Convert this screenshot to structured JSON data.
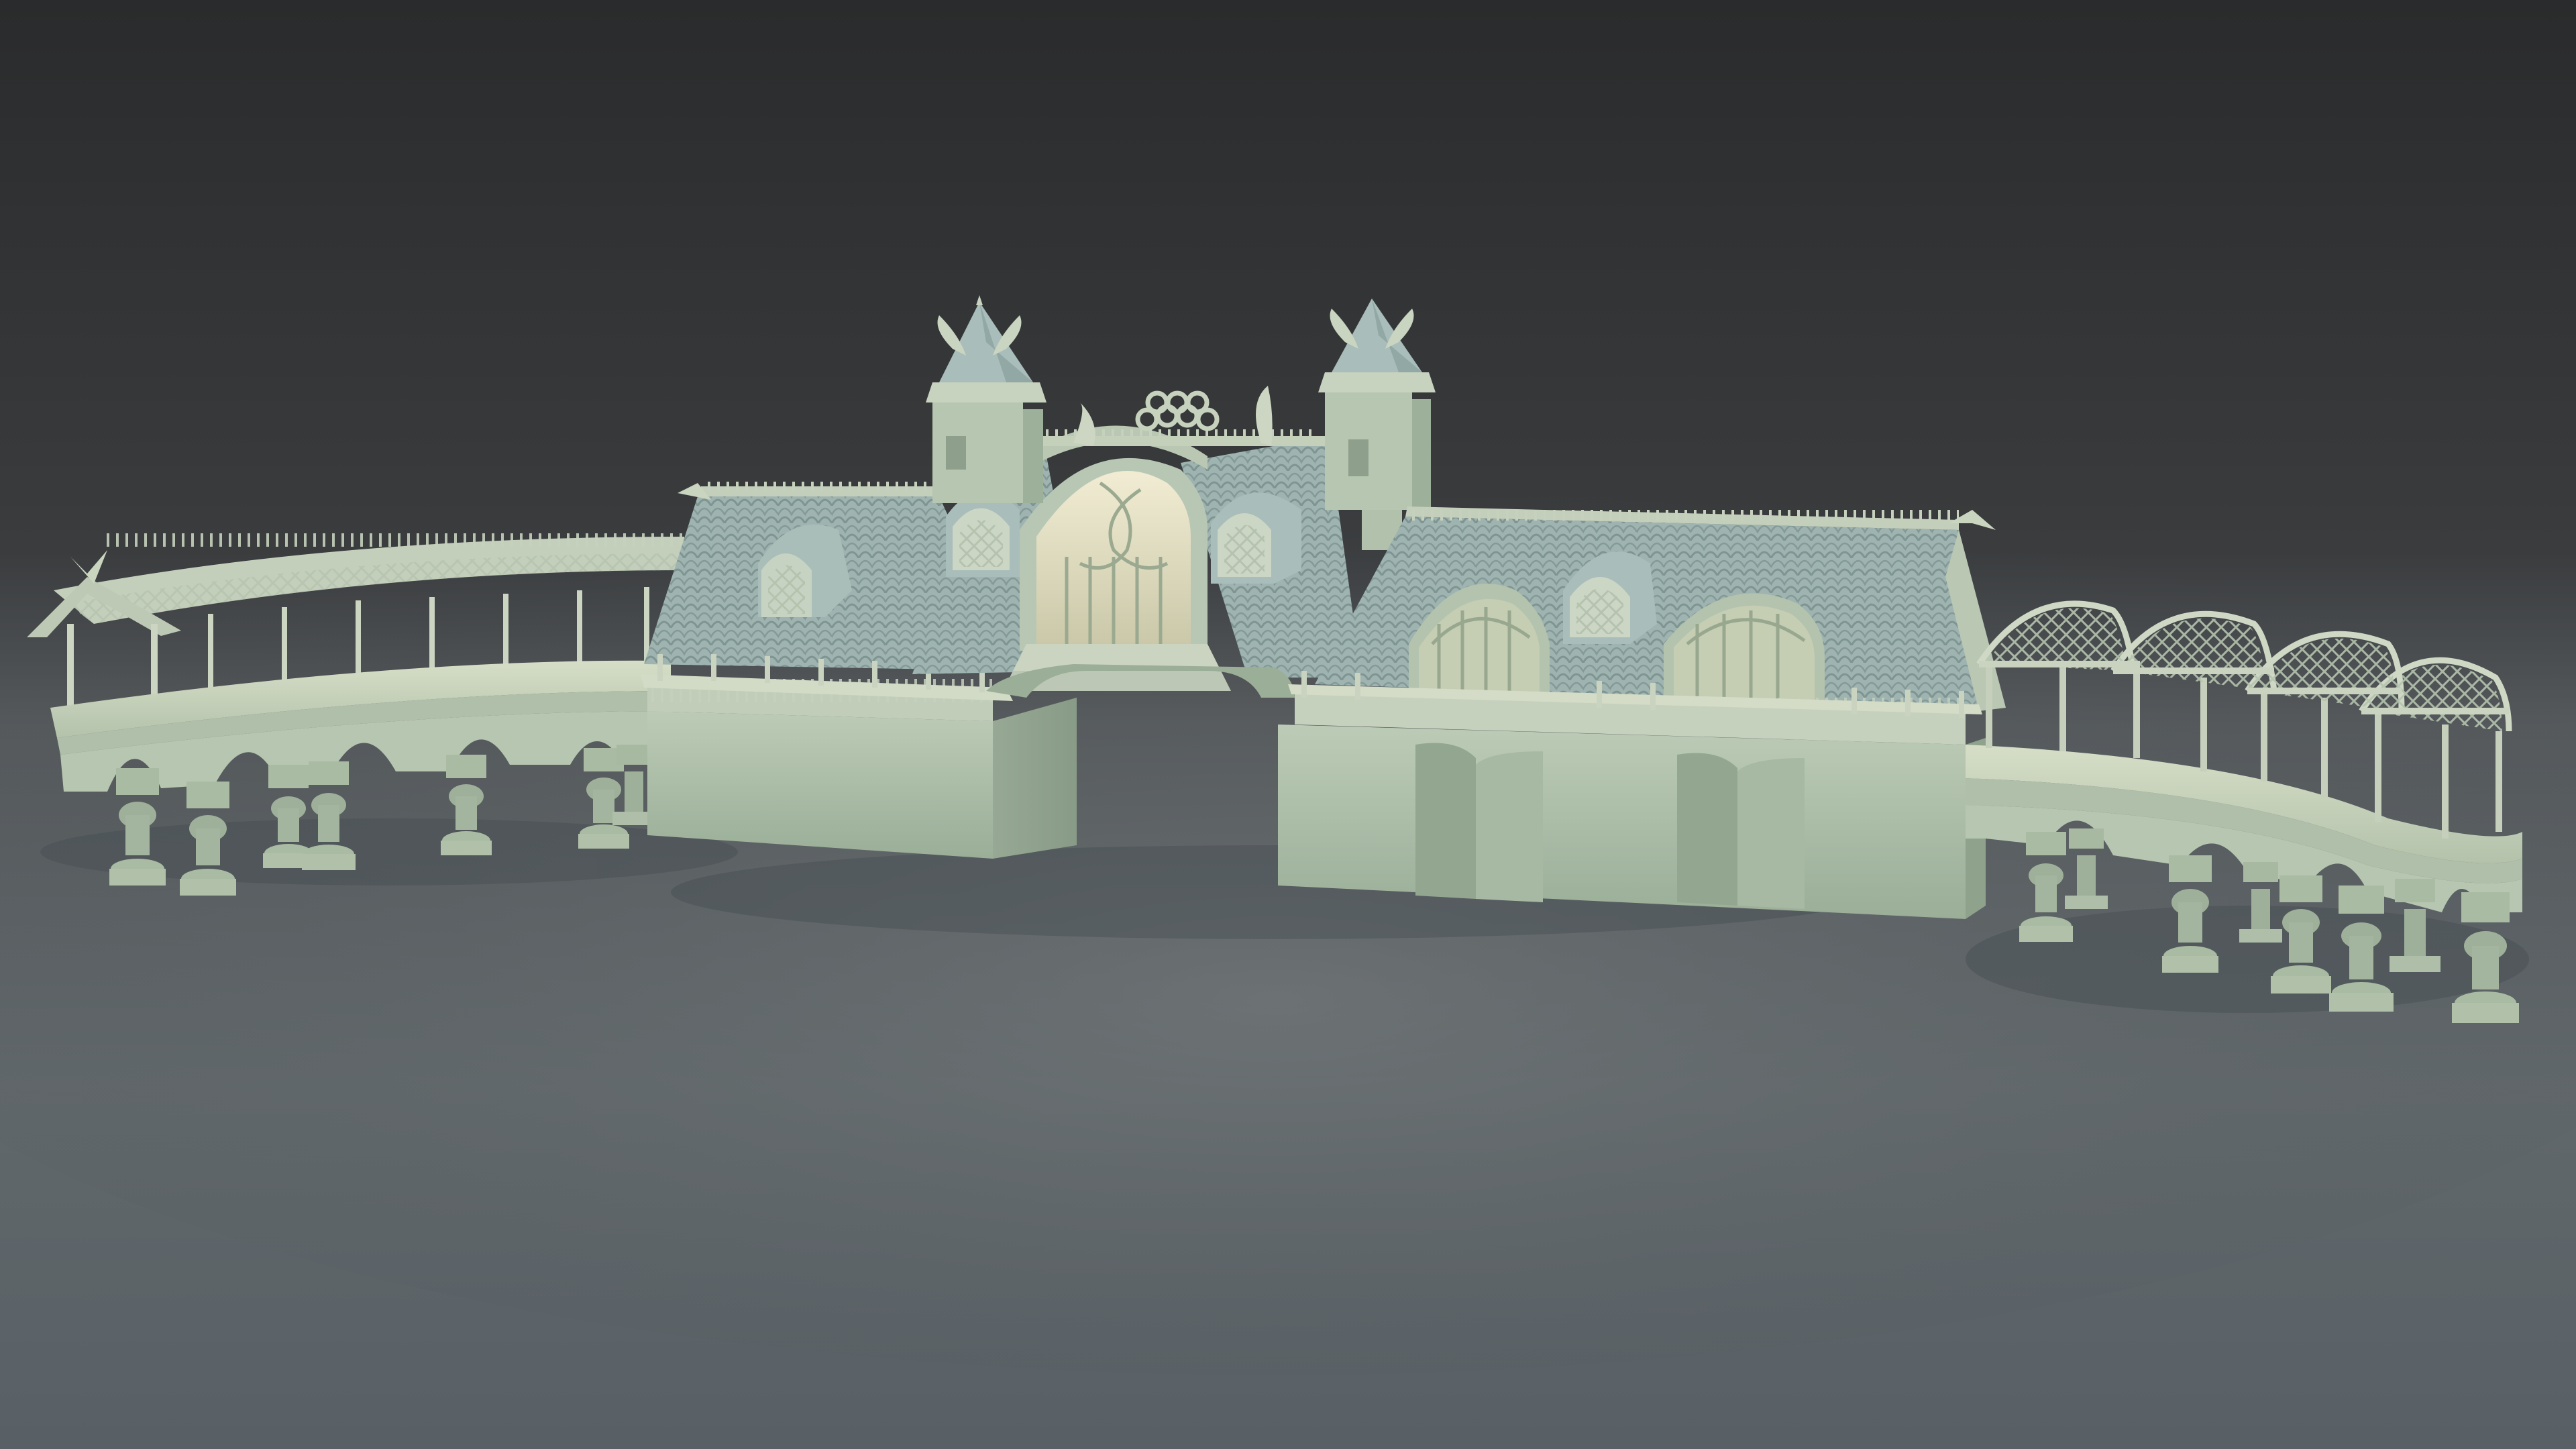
{
  "scene": {
    "subject": "bridge-pavilion-render",
    "colors": {
      "background_top": "#333334",
      "background_floor": "#5d6468",
      "floor_far": "#6f7679",
      "model_light": "#cfd9c4",
      "model_mid": "#aebfaa",
      "model_shadow": "#879883",
      "roof_tile": "#9fb3b0",
      "roof_tile_dark": "#7f9693",
      "interior_glow": "#e6e2c8",
      "warm_rim": "#d8cfa3"
    }
  }
}
